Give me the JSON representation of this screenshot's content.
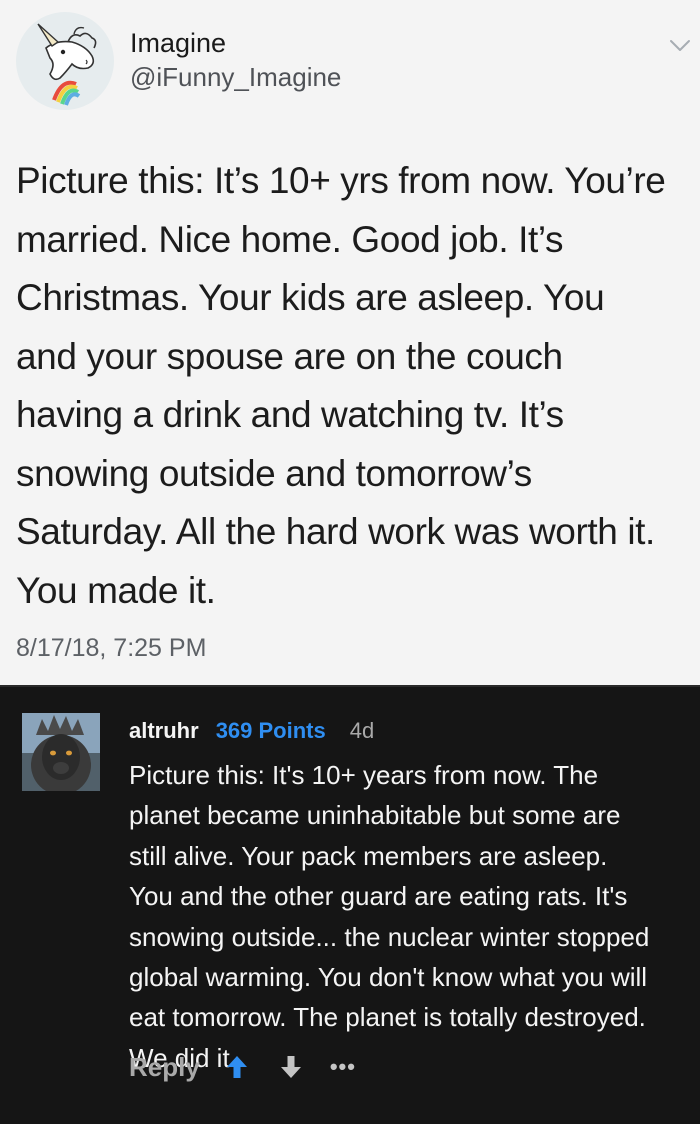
{
  "tweet": {
    "display_name": "Imagine",
    "handle": "@iFunny_Imagine",
    "text": "Picture this: It’s 10+ yrs from now. You’re\nmarried. Nice home. Good job. It’s\nChristmas. Your kids are asleep. You\nand your spouse are on the couch\nhaving a drink and watching tv. It’s\nsnowing outside and tomorrow’s\nSaturday. All the hard work was worth it.\nYou made it.",
    "timestamp": "8/17/18, 7:25 PM",
    "avatar_icon": "unicorn-avatar",
    "menu_icon": "chevron-down-icon"
  },
  "comment": {
    "username": "altruhr",
    "points": "369 Points",
    "age": "4d",
    "text": "Picture this: It's 10+ years from now. The\nplanet became uninhabitable but some are\nstill alive. Your pack members are asleep.\nYou and the other guard are eating rats. It's\nsnowing outside... the nuclear winter stopped\nglobal warming. You don't know what you will\neat tomorrow. The planet is totally destroyed.\nWe did it.",
    "reply_label": "Reply",
    "more_label": "•••",
    "avatar_icon": "monkey-avatar",
    "upvote_icon": "arrow-up-icon",
    "downvote_icon": "arrow-down-icon",
    "colors": {
      "points": "#2f8ef1",
      "upvote": "#2f8ef1",
      "background": "#151515"
    }
  }
}
